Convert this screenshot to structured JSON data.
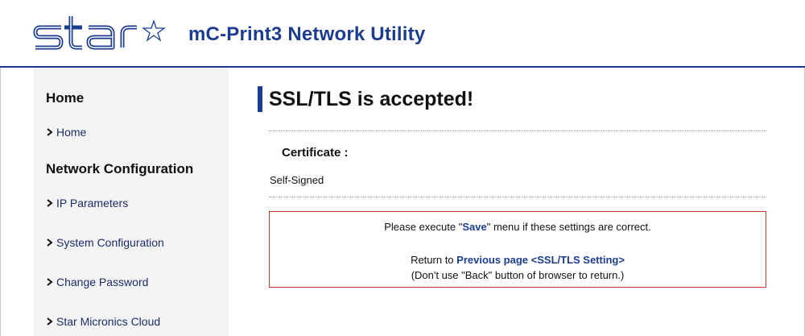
{
  "header": {
    "logo_text": "star",
    "title": "mC-Print3 Network Utility"
  },
  "sidebar": {
    "heading_home": "Home",
    "home_link": "Home",
    "heading_network": "Network Configuration",
    "items": [
      {
        "label": "IP Parameters"
      },
      {
        "label": "System Configuration"
      },
      {
        "label": "Change Password"
      },
      {
        "label": "Star Micronics Cloud"
      }
    ]
  },
  "main": {
    "title": "SSL/TLS is accepted!",
    "certificate_label": "Certificate :",
    "certificate_value": "Self-Signed",
    "notice": {
      "line1_pre": "Please execute \"",
      "line1_save": "Save",
      "line1_post": "\" menu if these settings are correct.",
      "line2_pre": "Return to ",
      "line2_link": "Previous page <SSL/TLS Setting>",
      "line3": "(Don't use \"Back\" button of browser to return.)"
    }
  },
  "colors": {
    "brand_blue": "#1c3d8f",
    "notice_border": "#c0392b",
    "sidebar_bg": "#f4f4f4"
  }
}
